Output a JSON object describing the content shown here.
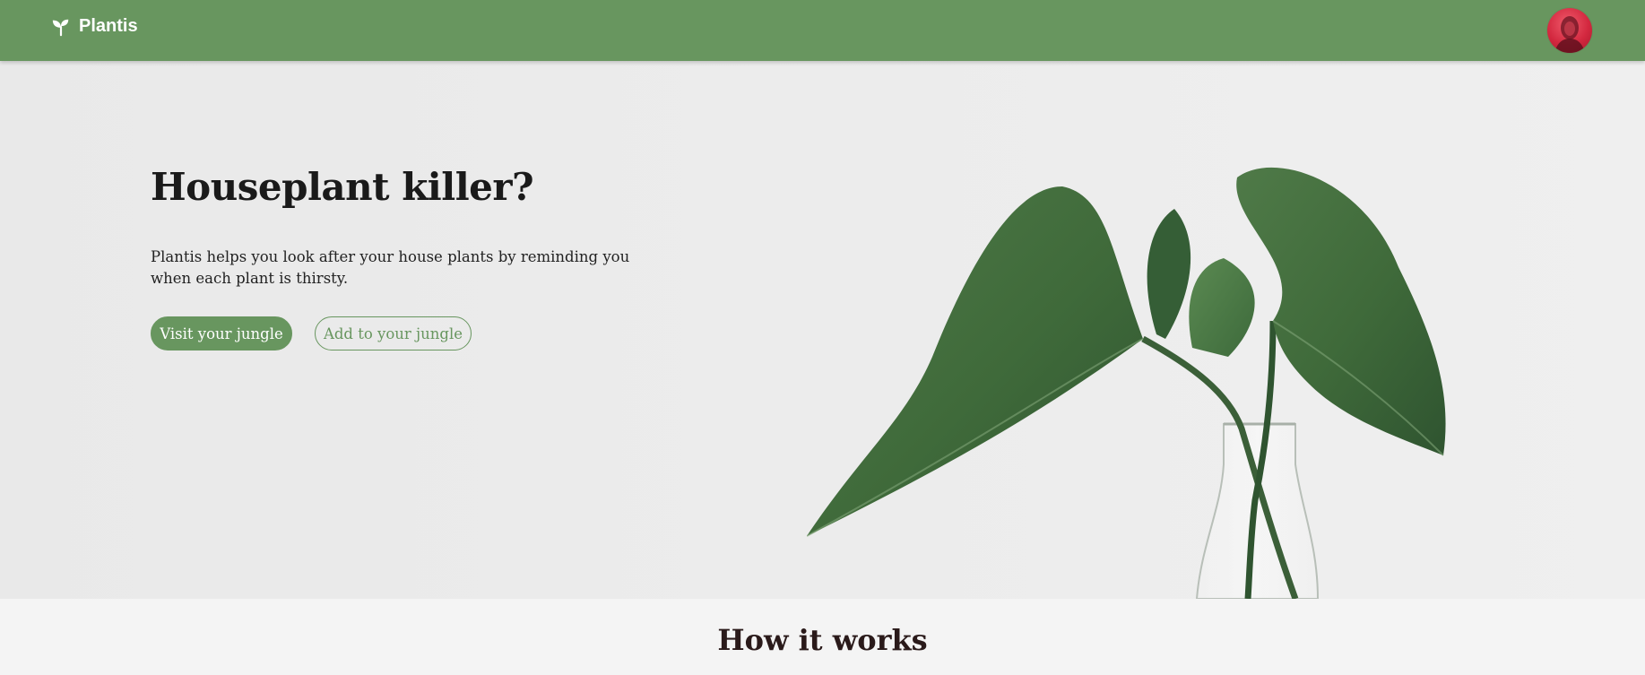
{
  "nav": {
    "brand": "Plantis",
    "brand_icon": "sprout-icon",
    "avatar": "user-avatar"
  },
  "hero": {
    "title": "Houseplant killer?",
    "text": "Plantis helps you look after your house plants by reminding you when each plant is thirsty.",
    "primary_button": "Visit your jungle",
    "secondary_button": "Add to your jungle"
  },
  "how_it_works": {
    "title": "How it works"
  },
  "colors": {
    "brand_green": "#68965f",
    "avatar_red": "#d3283f",
    "hero_bg": "#ececec",
    "section_bg": "#f4f4f4"
  }
}
